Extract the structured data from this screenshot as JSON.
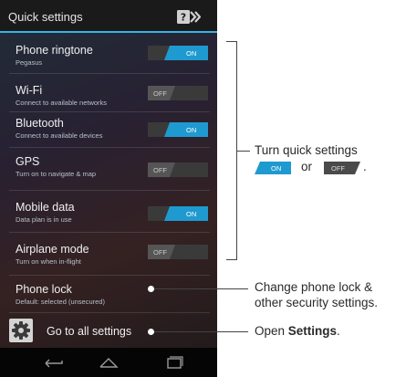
{
  "header": {
    "title": "Quick settings"
  },
  "rows": [
    {
      "title": "Phone ringtone",
      "sub": "Pegasus",
      "toggle": "ON"
    },
    {
      "title": "Wi-Fi",
      "sub": "Connect to available networks",
      "toggle": "OFF"
    },
    {
      "title": "Bluetooth",
      "sub": "Connect to available devices",
      "toggle": "ON"
    },
    {
      "title": "GPS",
      "sub": "Turn on to navigate & map",
      "toggle": "OFF"
    },
    {
      "title": "Mobile data",
      "sub": "Data plan is in use",
      "toggle": "ON"
    },
    {
      "title": "Airplane mode",
      "sub": "Turn on when in-flight",
      "toggle": "OFF"
    },
    {
      "title": "Phone lock",
      "sub": "Default: selected (unsecured)"
    }
  ],
  "settings": {
    "label": "Go to all settings"
  },
  "callouts": {
    "quick": {
      "line1": "Turn quick settings",
      "on": "ON",
      "or": "or",
      "off": "OFF",
      "period": "."
    },
    "lock": {
      "line1": "Change phone lock &",
      "line2": "other security settings."
    },
    "open": {
      "prefix": "Open ",
      "bold": "Settings",
      "suffix": "."
    }
  },
  "colors": {
    "accent": "#33b5e5",
    "toggle_on": "#1f9ad0",
    "toggle_off": "#4a4a4a"
  }
}
